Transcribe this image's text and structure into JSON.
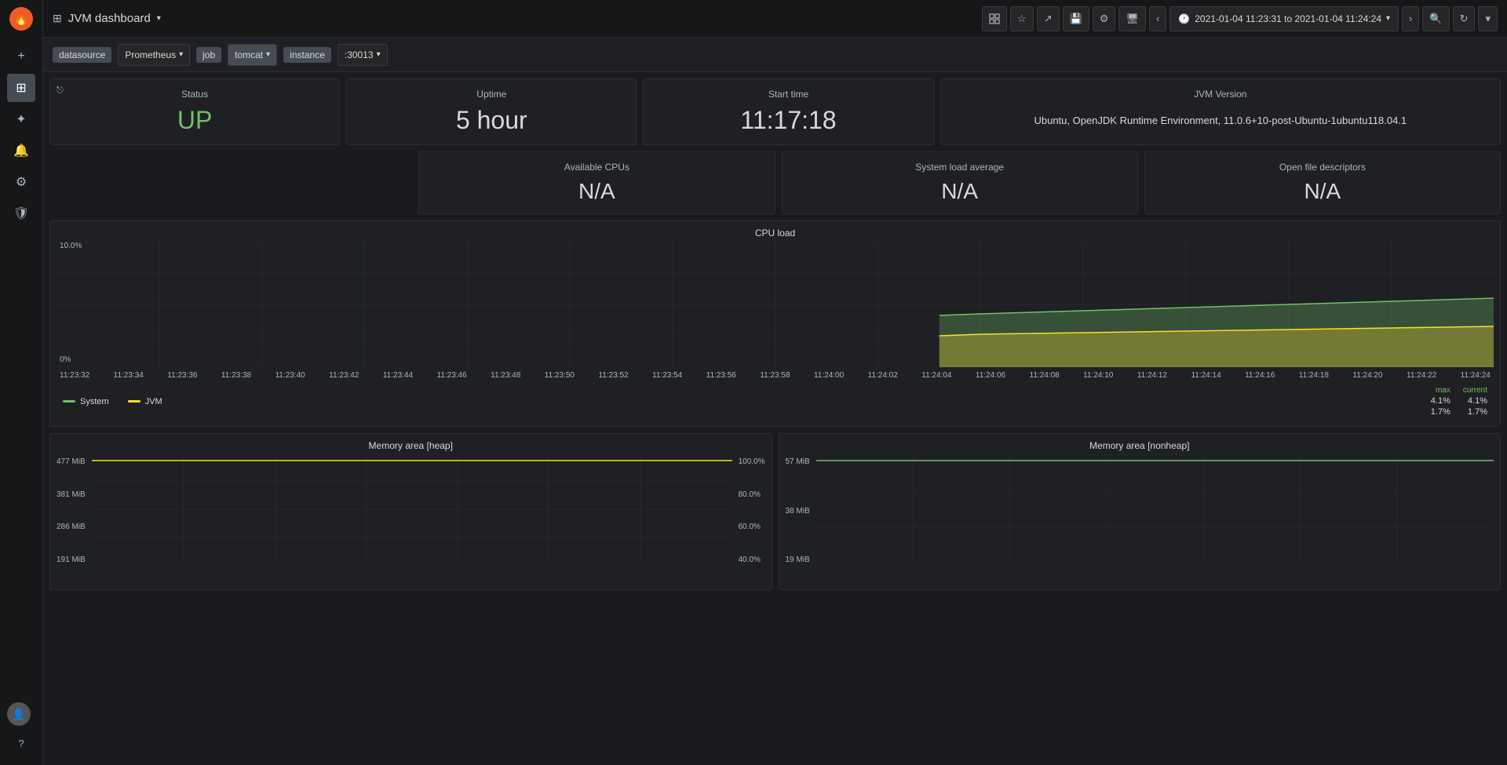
{
  "app": {
    "title": "JVM dashboard",
    "logo_char": "🔥"
  },
  "sidebar": {
    "icons": [
      {
        "name": "plus-icon",
        "symbol": "+",
        "interactable": true
      },
      {
        "name": "grid-icon",
        "symbol": "⊞",
        "interactable": true,
        "active": true
      },
      {
        "name": "compass-icon",
        "symbol": "✦",
        "interactable": true
      },
      {
        "name": "bell-icon",
        "symbol": "🔔",
        "interactable": true
      },
      {
        "name": "gear-icon",
        "symbol": "⚙",
        "interactable": true
      },
      {
        "name": "shield-icon",
        "symbol": "🛡",
        "interactable": true
      }
    ],
    "avatar_char": "👤",
    "help_char": "?"
  },
  "topnav": {
    "title": "JVM dashboard",
    "caret": "▾",
    "grid_icon": "⊞",
    "buttons": {
      "star": "☆",
      "share": "↗",
      "save": "💾",
      "settings": "⚙",
      "tv": "🖥",
      "prev": "‹",
      "next": "›",
      "search": "🔍",
      "refresh": "↻",
      "more": "⋮"
    },
    "time_range": "2021-01-04 11:23:31 to 2021-01-04 11:24:24"
  },
  "filterbar": {
    "datasource_label": "datasource",
    "datasource_value": "Prometheus",
    "job_label": "job",
    "job_value": "tomcat",
    "instance_label": "instance",
    "instance_value": ":30013"
  },
  "panels": {
    "row1": [
      {
        "id": "status",
        "title": "Status",
        "value": "UP",
        "type": "up",
        "link": true
      },
      {
        "id": "uptime",
        "title": "Uptime",
        "value": "5 hour",
        "type": "normal"
      },
      {
        "id": "start_time",
        "title": "Start time",
        "value": "11:17:18",
        "type": "normal"
      },
      {
        "id": "jvm_version",
        "title": "JVM Version",
        "value": "Ubuntu, OpenJDK Runtime Environment, 11.0.6+10-post-Ubuntu-1ubuntu118.04.1",
        "type": "jvm-version"
      }
    ],
    "row2": [
      {
        "id": "available_cpus",
        "title": "Available CPUs",
        "value": "N/A",
        "type": "na"
      },
      {
        "id": "system_load",
        "title": "System load average",
        "value": "N/A",
        "type": "na"
      },
      {
        "id": "open_files",
        "title": "Open file descriptors",
        "value": "N/A",
        "type": "na"
      }
    ]
  },
  "cpu_chart": {
    "title": "CPU load",
    "y_top": "10.0%",
    "y_bottom": "0%",
    "x_labels": [
      "11:23:32",
      "11:23:34",
      "11:23:36",
      "11:23:38",
      "11:23:40",
      "11:23:42",
      "11:23:44",
      "11:23:46",
      "11:23:48",
      "11:23:50",
      "11:23:52",
      "11:23:54",
      "11:23:56",
      "11:23:58",
      "11:24:00",
      "11:24:02",
      "11:24:04",
      "11:24:06",
      "11:24:08",
      "11:24:10",
      "11:24:12",
      "11:24:14",
      "11:24:16",
      "11:24:18",
      "11:24:20",
      "11:24:22",
      "11:24:24"
    ],
    "legend": {
      "system_label": "System",
      "system_color": "#73bf69",
      "jvm_label": "JVM",
      "jvm_color": "#fade2a",
      "max_label": "max",
      "current_label": "current",
      "system_max": "4.1%",
      "system_current": "4.1%",
      "jvm_max": "1.7%",
      "jvm_current": "1.7%"
    }
  },
  "memory_heap": {
    "title": "Memory area [heap]",
    "y_labels": [
      "477 MiB",
      "381 MiB",
      "286 MiB",
      "191 MiB"
    ],
    "y_right_labels": [
      "100.0%",
      "80.0%",
      "60.0%",
      "40.0%"
    ]
  },
  "memory_nonheap": {
    "title": "Memory area [nonheap]",
    "y_labels": [
      "57 MiB",
      "38 MiB",
      "19 MiB"
    ]
  }
}
